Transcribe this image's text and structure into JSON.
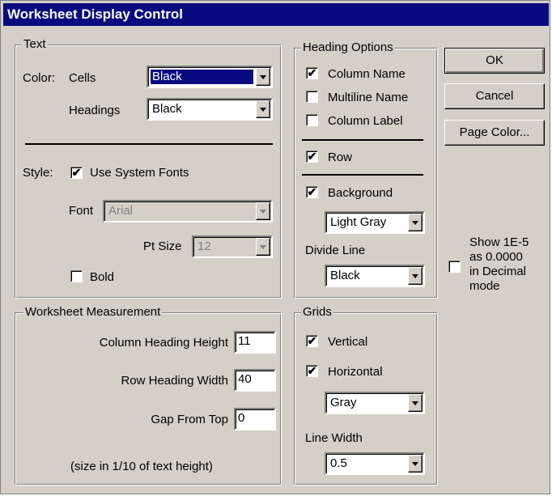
{
  "window": {
    "title": "Worksheet Display Control"
  },
  "text_group": {
    "legend": "Text",
    "color_label": "Color:",
    "cells_label": "Cells",
    "cells_value": "Black",
    "headings_label": "Headings",
    "headings_value": "Black",
    "style_label": "Style:",
    "use_system_fonts": {
      "label": "Use System Fonts",
      "checked": true
    },
    "font_label": "Font",
    "font_value": "Arial",
    "pt_size_label": "Pt Size",
    "pt_size_value": "12",
    "bold": {
      "label": "Bold",
      "checked": false
    }
  },
  "heading_options": {
    "legend": "Heading Options",
    "column_name": {
      "label": "Column Name",
      "checked": true
    },
    "multiline_name": {
      "label": "Multiline Name",
      "checked": false
    },
    "column_label": {
      "label": "Column Label",
      "checked": false
    },
    "row": {
      "label": "Row",
      "checked": true
    },
    "background": {
      "label": "Background",
      "checked": true
    },
    "background_color": "Light Gray",
    "divide_line_label": "Divide Line",
    "divide_line_color": "Black"
  },
  "buttons": {
    "ok": "OK",
    "cancel": "Cancel",
    "page_color": "Page Color..."
  },
  "decimal_option": {
    "lines": [
      "Show 1E-5",
      "as 0.0000",
      "in Decimal",
      "mode"
    ],
    "checked": false
  },
  "measurement": {
    "legend": "Worksheet Measurement",
    "column_heading_height_label": "Column Heading Height",
    "column_heading_height_value": "11",
    "row_heading_width_label": "Row Heading Width",
    "row_heading_width_value": "40",
    "gap_from_top_label": "Gap From Top",
    "gap_from_top_value": "0",
    "note": "(size in 1/10 of text height)"
  },
  "grids": {
    "legend": "Grids",
    "vertical": {
      "label": "Vertical",
      "checked": true
    },
    "horizontal": {
      "label": "Horizontal",
      "checked": true
    },
    "grid_color": "Gray",
    "line_width_label": "Line Width",
    "line_width_value": "0.5"
  },
  "check_mark": "✔"
}
